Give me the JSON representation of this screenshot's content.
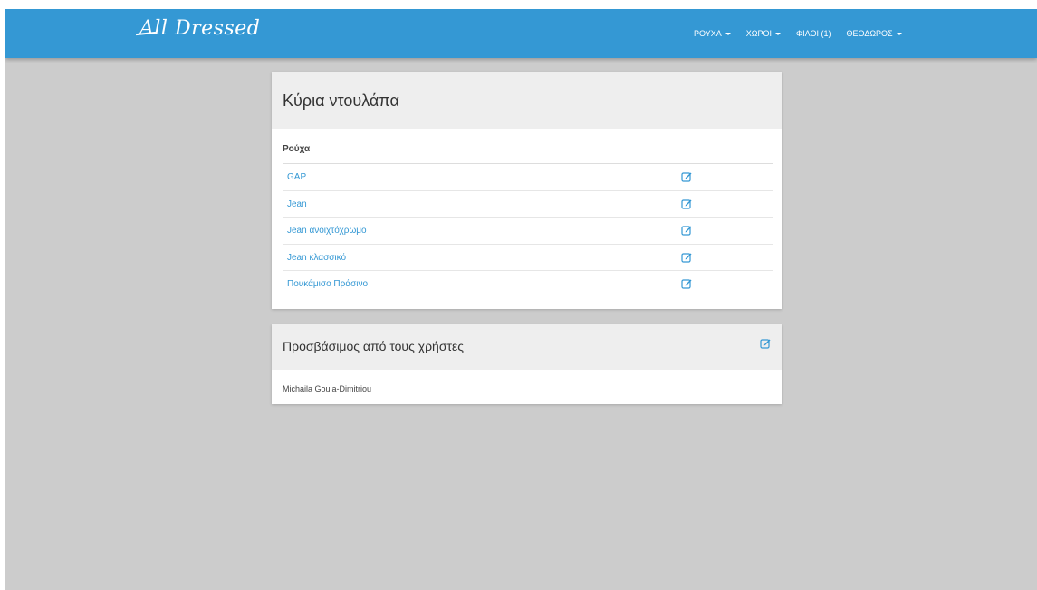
{
  "colors": {
    "navbar": "#3498d4",
    "link": "#3498d4",
    "page_background": "#cccccc",
    "panel_header": "#eeeeee"
  },
  "brand": {
    "logo_text": "All Dressed"
  },
  "nav": {
    "items": [
      {
        "label": "ΡΟΥΧΑ",
        "has_dropdown": true,
        "icon": "caret-down-icon"
      },
      {
        "label": "ΧΩΡΟΙ",
        "has_dropdown": true,
        "icon": "caret-down-icon"
      },
      {
        "label": "ΦΙΛΟΙ (1)",
        "has_dropdown": false
      },
      {
        "label": "ΘΕΟΔΩΡΟΣ",
        "has_dropdown": true,
        "icon": "caret-down-icon"
      }
    ]
  },
  "wardrobe": {
    "title": "Κύρια ντουλάπα",
    "column_header": "Ρούχα",
    "edit_icon": "edit-icon",
    "items": [
      {
        "label": "GAP"
      },
      {
        "label": "Jean"
      },
      {
        "label": "Jean ανοιχτόχρωμο"
      },
      {
        "label": "Jean κλασσικό"
      },
      {
        "label": "Πουκάμισο Πράσινο"
      }
    ]
  },
  "access": {
    "title": "Προσβάσιμος από τους χρήστες",
    "edit_icon": "edit-icon",
    "users": [
      "Michaila Goula-Dimitriou"
    ]
  }
}
